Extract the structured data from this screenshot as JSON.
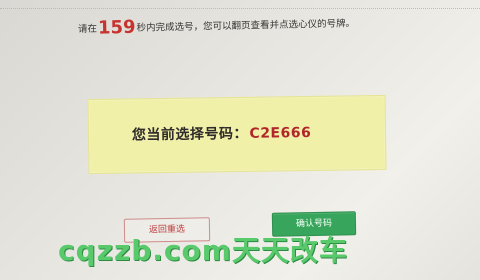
{
  "notice": {
    "prefix": "请在",
    "seconds": "159",
    "suffix": "秒内完成选号，您可以翻页查看并点选心仪的号牌。"
  },
  "selection": {
    "label": "您当前选择号码",
    "separator": "：",
    "value": "C2E666"
  },
  "buttons": {
    "back": "返回重选",
    "confirm": "确认号码"
  },
  "watermark": "cqzzb.com天天改车",
  "colors": {
    "panel_bg": "#f0f0a9",
    "seconds_red": "#c7332f",
    "value_red": "#b2262a",
    "confirm_green": "#37a55b",
    "watermark_green": "#59ca6c"
  }
}
